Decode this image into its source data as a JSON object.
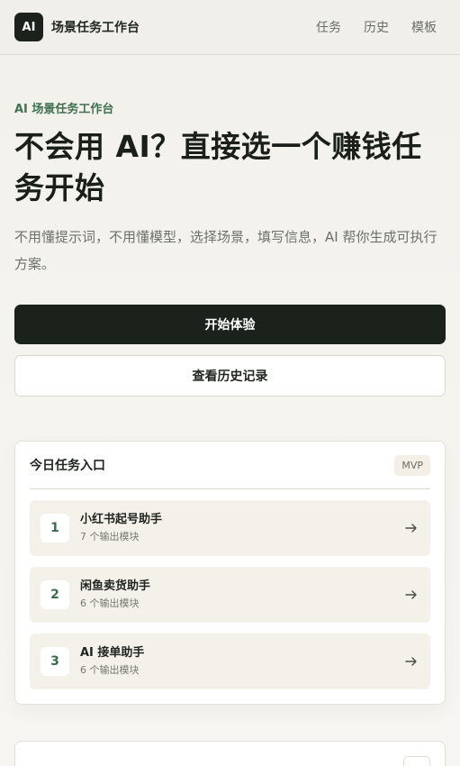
{
  "header": {
    "logo_text": "AI",
    "brand_name": "场景任务工作台",
    "nav": [
      {
        "label": "任务"
      },
      {
        "label": "历史"
      },
      {
        "label": "模板"
      }
    ]
  },
  "hero": {
    "eyebrow": "AI 场景任务工作台",
    "headline": "不会用 AI？直接选一个赚钱任务开始",
    "subtitle": "不用懂提示词，不用懂模型，选择场景，填写信息，AI 帮你生成可执行方案。",
    "primary_button": "开始体验",
    "secondary_button": "查看历史记录"
  },
  "today_card": {
    "title": "今日任务入口",
    "badge": "MVP",
    "tasks": [
      {
        "index": "1",
        "name": "小红书起号助手",
        "modules": "7 个输出模块"
      },
      {
        "index": "2",
        "name": "闲鱼卖货助手",
        "modules": "6 个输出模块"
      },
      {
        "index": "3",
        "name": "AI 接单助手",
        "modules": "6 个输出模块"
      }
    ]
  },
  "colors": {
    "accent_green": "#3f7050",
    "primary_dark": "#1b211b",
    "task_bg": "#f4f1ea"
  }
}
